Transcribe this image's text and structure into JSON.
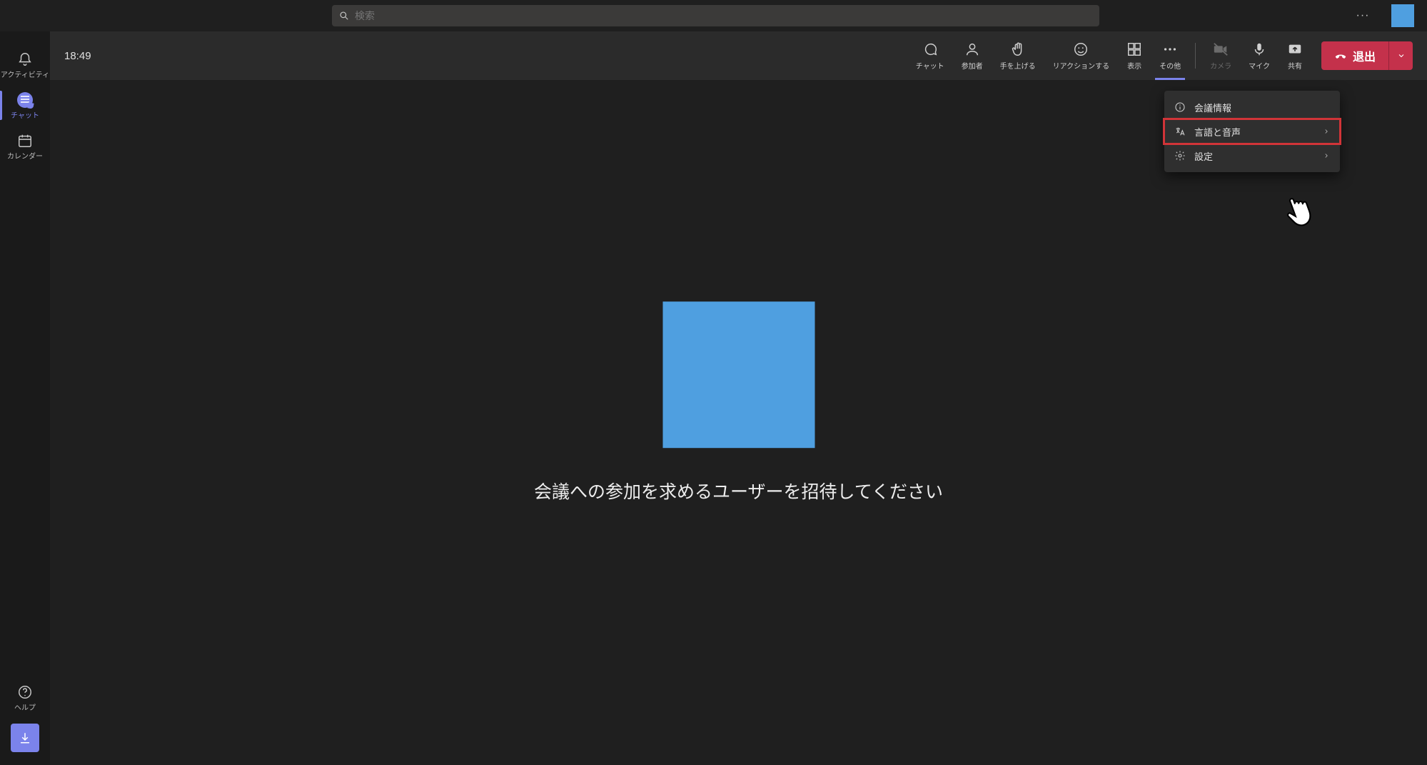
{
  "search": {
    "placeholder": "検索"
  },
  "rail": {
    "activity": "アクティビティ",
    "chat": "チャット",
    "calendar": "カレンダー",
    "help": "ヘルプ"
  },
  "meeting": {
    "time": "18:49",
    "tools": {
      "chat": "チャット",
      "people": "参加者",
      "raise": "手を上げる",
      "react": "リアクションする",
      "view": "表示",
      "more": "その他",
      "camera": "カメラ",
      "mic": "マイク",
      "share": "共有"
    },
    "leave": "退出"
  },
  "stage": {
    "invite": "会議への参加を求めるユーザーを招待してください"
  },
  "more_menu": {
    "info": "会議情報",
    "language": "言語と音声",
    "settings": "設定"
  }
}
